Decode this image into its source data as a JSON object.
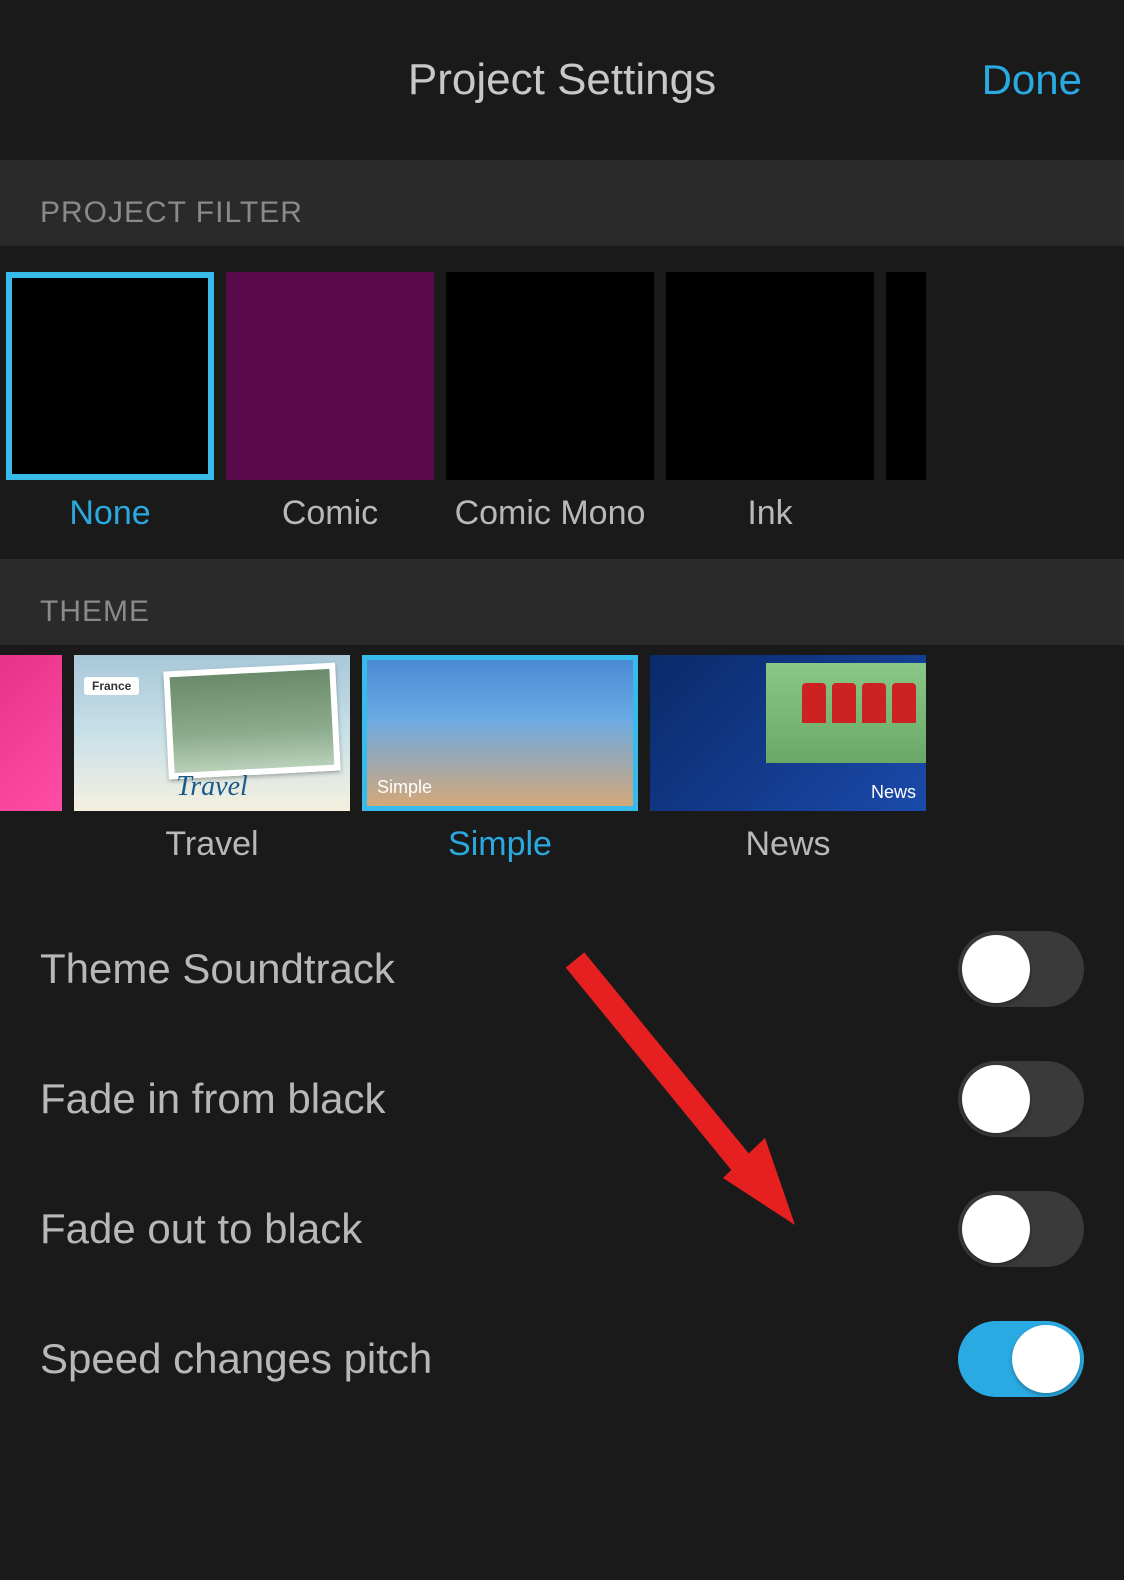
{
  "header": {
    "title": "Project Settings",
    "done_label": "Done"
  },
  "sections": {
    "filter": {
      "header": "PROJECT FILTER",
      "items": [
        {
          "label": "None",
          "selected": true
        },
        {
          "label": "Comic",
          "selected": false
        },
        {
          "label": "Comic Mono",
          "selected": false
        },
        {
          "label": "Ink",
          "selected": false
        }
      ]
    },
    "theme": {
      "header": "THEME",
      "items": [
        {
          "label": "Travel",
          "selected": false,
          "overlay": "Travel",
          "badge": "France"
        },
        {
          "label": "Simple",
          "selected": true,
          "overlay": "Simple"
        },
        {
          "label": "News",
          "selected": false,
          "overlay": "News"
        }
      ]
    }
  },
  "settings": [
    {
      "label": "Theme Soundtrack",
      "on": false
    },
    {
      "label": "Fade in from black",
      "on": false
    },
    {
      "label": "Fade out to black",
      "on": false
    },
    {
      "label": "Speed changes pitch",
      "on": true
    }
  ],
  "colors": {
    "accent": "#2aaae2",
    "background": "#1a1a1a"
  }
}
